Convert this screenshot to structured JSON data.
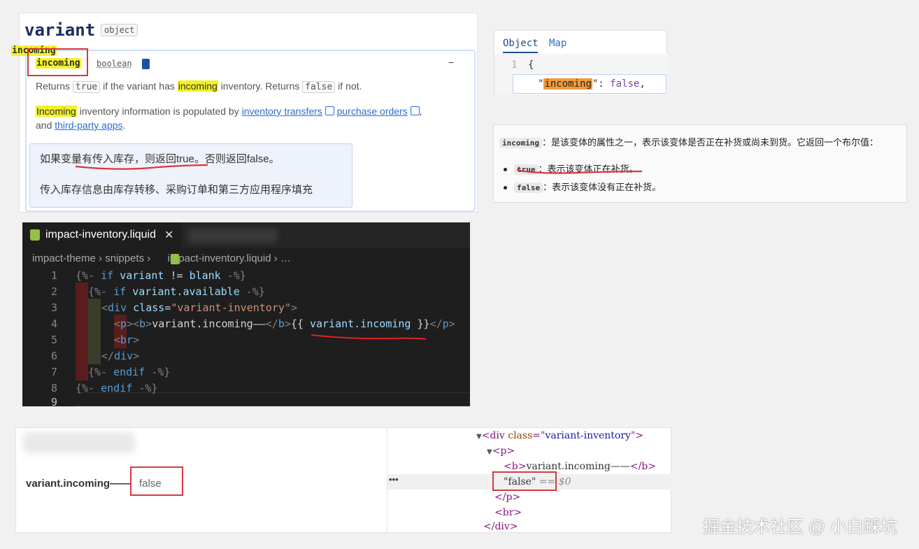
{
  "docs": {
    "title": "variant",
    "title_type": "object",
    "property_name": "incoming",
    "property_type": "boolean",
    "collapse_symbol": "−",
    "returns_1": "Returns",
    "true_chip": "true",
    "returns_2": "if the variant has",
    "returns_hl": "incoming",
    "returns_3": "inventory. Returns",
    "false_chip": "false",
    "returns_4": "if not.",
    "populated_hl": "Incoming",
    "populated_1": "inventory information is populated by",
    "link_transfers": "inventory transfers",
    "link_orders": "purchase orders",
    "and_text": "and",
    "link_apps": "third-party apps",
    "period": ".",
    "comma": ",",
    "translation_1": "如果变量有传入库存，则返回true。否则返回false。",
    "translation_2": "传入库存信息由库存转移、采购订单和第三方应用程序填充"
  },
  "json_panel": {
    "tab_object": "Object",
    "tab_map": "Map",
    "line_no": "1",
    "brace": "{",
    "quote_open": "\"",
    "key": "incoming",
    "quote_close_colon": "\": ",
    "value": "false",
    "comma": ","
  },
  "explain": {
    "term": "incoming",
    "line1": "：是该变体的属性之一，表示该变体是否正在补货或尚未到货。它返回一个布尔值：",
    "true_chip": "true",
    "true_desc": "：表示该变体正在补货。",
    "false_chip": "false",
    "false_desc": "：表示该变体没有正在补货。"
  },
  "editor": {
    "tab_label": "impact-inventory.liquid",
    "tab_close": "✕",
    "crumb_1": "impact-theme",
    "crumb_sep": " › ",
    "crumb_2": "snippets",
    "crumb_3": "impact-inventory.liquid",
    "crumb_more": "…",
    "line_numbers": [
      "1",
      "2",
      "3",
      "4",
      "5",
      "6",
      "7",
      "8",
      "9"
    ],
    "line1_a": "{%-",
    "line1_b": "if",
    "line1_c": "variant",
    "line1_d": "!=",
    "line1_e": "blank",
    "line1_f": "-%}",
    "line2_a": "{%-",
    "line2_b": "if",
    "line2_c": "variant.available",
    "line2_d": "-%}",
    "line3_a": "<",
    "line3_b": "div",
    "line3_c": "class",
    "line3_d": "=",
    "line3_e": "\"variant-inventory\"",
    "line3_f": ">",
    "line4_a": "<",
    "line4_b": "p",
    "line4_c": "><",
    "line4_d": "b",
    "line4_e": ">",
    "line4_f": "variant.incoming——",
    "line4_g": "</",
    "line4_h": "b",
    "line4_i": ">",
    "line4_j": "{{",
    "line4_k": "variant.incoming",
    "line4_l": "}}",
    "line4_m": "</",
    "line4_n": "p",
    "line4_o": ">",
    "line5_a": "<",
    "line5_b": "br",
    "line5_c": ">",
    "line6_a": "</",
    "line6_b": "div",
    "line6_c": ">",
    "line7_a": "{%-",
    "line7_b": "endif",
    "line7_c": "-%}",
    "line8_a": "{%-",
    "line8_b": "endif",
    "line8_c": "-%}"
  },
  "rendered": {
    "label": "variant.incoming——",
    "value": "false"
  },
  "devtools": {
    "div_open_a": "<div ",
    "div_attr": "class",
    "div_eq": "=\"",
    "div_val": "variant-inventory",
    "div_close": "\">",
    "p_open": "<p>",
    "b_open": "<b>",
    "b_text": "variant.incoming——",
    "b_close": "</b>",
    "text_node": "\"false\"",
    "eq_sel": " == $0",
    "p_close": "</p>",
    "br": "<br>",
    "div_end": "</div>",
    "ellipsis": "•••",
    "triangle": "▼"
  },
  "watermark": "掘金技术社区 @ 小白踩坑",
  "colors": {
    "highlight_yellow": "#f3f12a",
    "highlight_orange": "#f19a3a",
    "annotation_red": "#d9363e",
    "link_blue": "#2c6ecb",
    "editor_bg": "#1e1e1e",
    "shopify_green": "#95bf47"
  }
}
